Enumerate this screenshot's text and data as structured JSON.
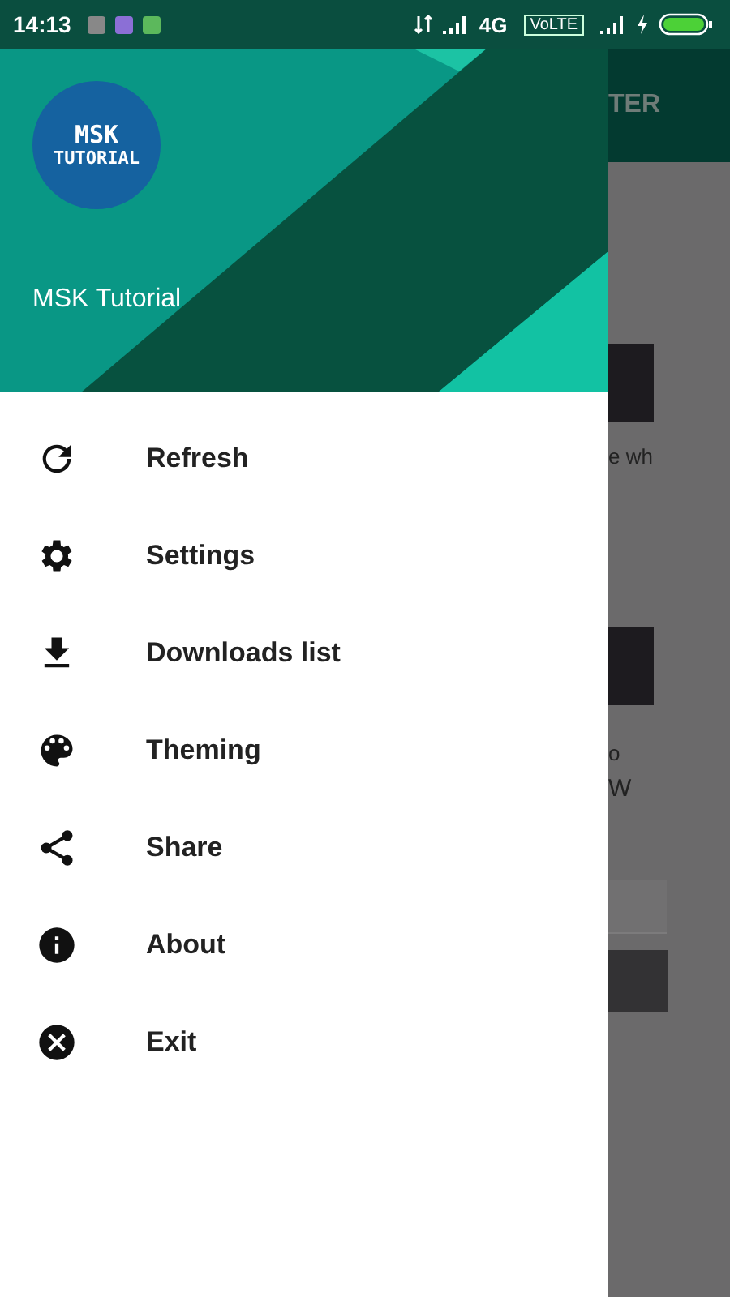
{
  "status_bar": {
    "time": "14:13",
    "network": "4G",
    "volte": "VoLTE"
  },
  "drawer": {
    "header": {
      "title": "MSK Tutorial",
      "logo": [
        "MSK",
        "TUTORIAL"
      ]
    },
    "items": [
      {
        "label": "Refresh"
      },
      {
        "label": "Settings"
      },
      {
        "label": "Downloads list"
      },
      {
        "label": "Theming"
      },
      {
        "label": "Share"
      },
      {
        "label": "About"
      },
      {
        "label": "Exit"
      }
    ]
  },
  "background_screen": {
    "app_bar_title": "TER",
    "texts": [
      "e wh",
      "o",
      "W"
    ]
  }
}
